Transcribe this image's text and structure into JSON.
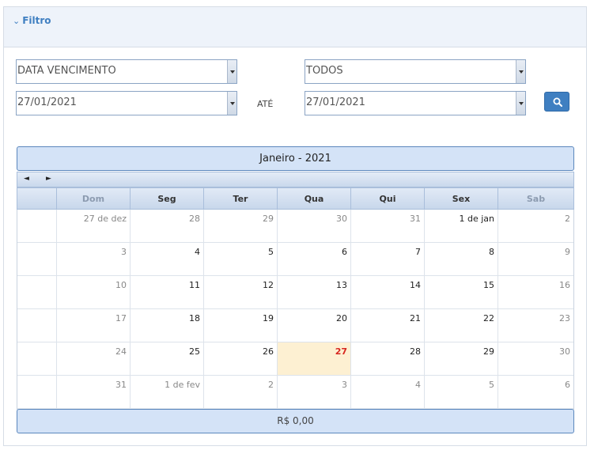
{
  "filter": {
    "title": "Filtro",
    "date_field": "DATA VENCIMENTO",
    "status": "TODOS",
    "date_from": "27/01/2021",
    "until_label": "ATÉ",
    "date_to": "27/01/2021"
  },
  "calendar": {
    "title": "Janeiro - 2021",
    "prev": "◄",
    "next": "►",
    "weekdays": [
      "Dom",
      "Seg",
      "Ter",
      "Qua",
      "Qui",
      "Sex",
      "Sab"
    ],
    "weeks": [
      [
        "27 de dez",
        "28",
        "29",
        "30",
        "31",
        "1 de jan",
        "2"
      ],
      [
        "3",
        "4",
        "5",
        "6",
        "7",
        "8",
        "9"
      ],
      [
        "10",
        "11",
        "12",
        "13",
        "14",
        "15",
        "16"
      ],
      [
        "17",
        "18",
        "19",
        "20",
        "21",
        "22",
        "23"
      ],
      [
        "24",
        "25",
        "26",
        "27",
        "28",
        "29",
        "30"
      ],
      [
        "31",
        "1 de fev",
        "2",
        "3",
        "4",
        "5",
        "6"
      ]
    ],
    "today": "27",
    "footer_total": "R$ 0,00"
  },
  "colors": {
    "accent": "#3f7fc1",
    "today_bg": "#fdf0d2",
    "today_text": "#d7261f"
  }
}
